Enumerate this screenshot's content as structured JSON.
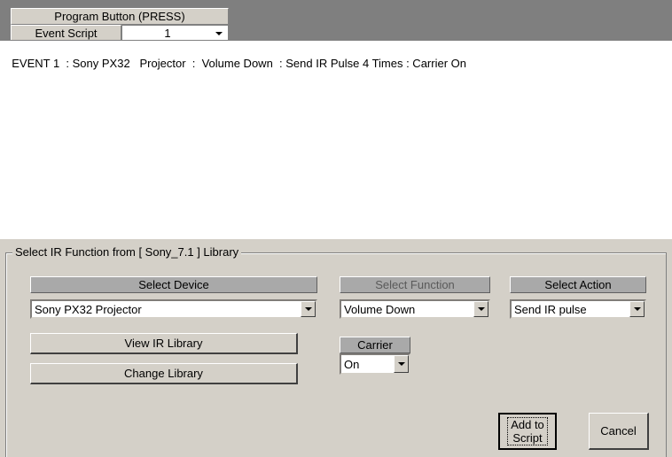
{
  "header": {
    "program_button": "Program Button (PRESS)",
    "event_script_label": "Event Script",
    "event_script_value": "1"
  },
  "script": {
    "text": "EVENT 1  : Sony PX32   Projector  :  Volume Down  : Send IR Pulse 4 Times : Carrier On"
  },
  "library_group": {
    "title": "Select IR Function from [ Sony_7.1 ] Library",
    "device_header": "Select Device",
    "device_value": "Sony PX32   Projector",
    "function_header": "Select Function",
    "function_value": "Volume Down",
    "action_header": "Select Action",
    "action_value": "Send  IR pulse",
    "carrier_header": "Carrier",
    "carrier_value": "On",
    "view_library_label": "View IR Library",
    "change_library_label": "Change Library",
    "add_script_line1": "Add to",
    "add_script_line2": "Script",
    "cancel_label": "Cancel"
  }
}
